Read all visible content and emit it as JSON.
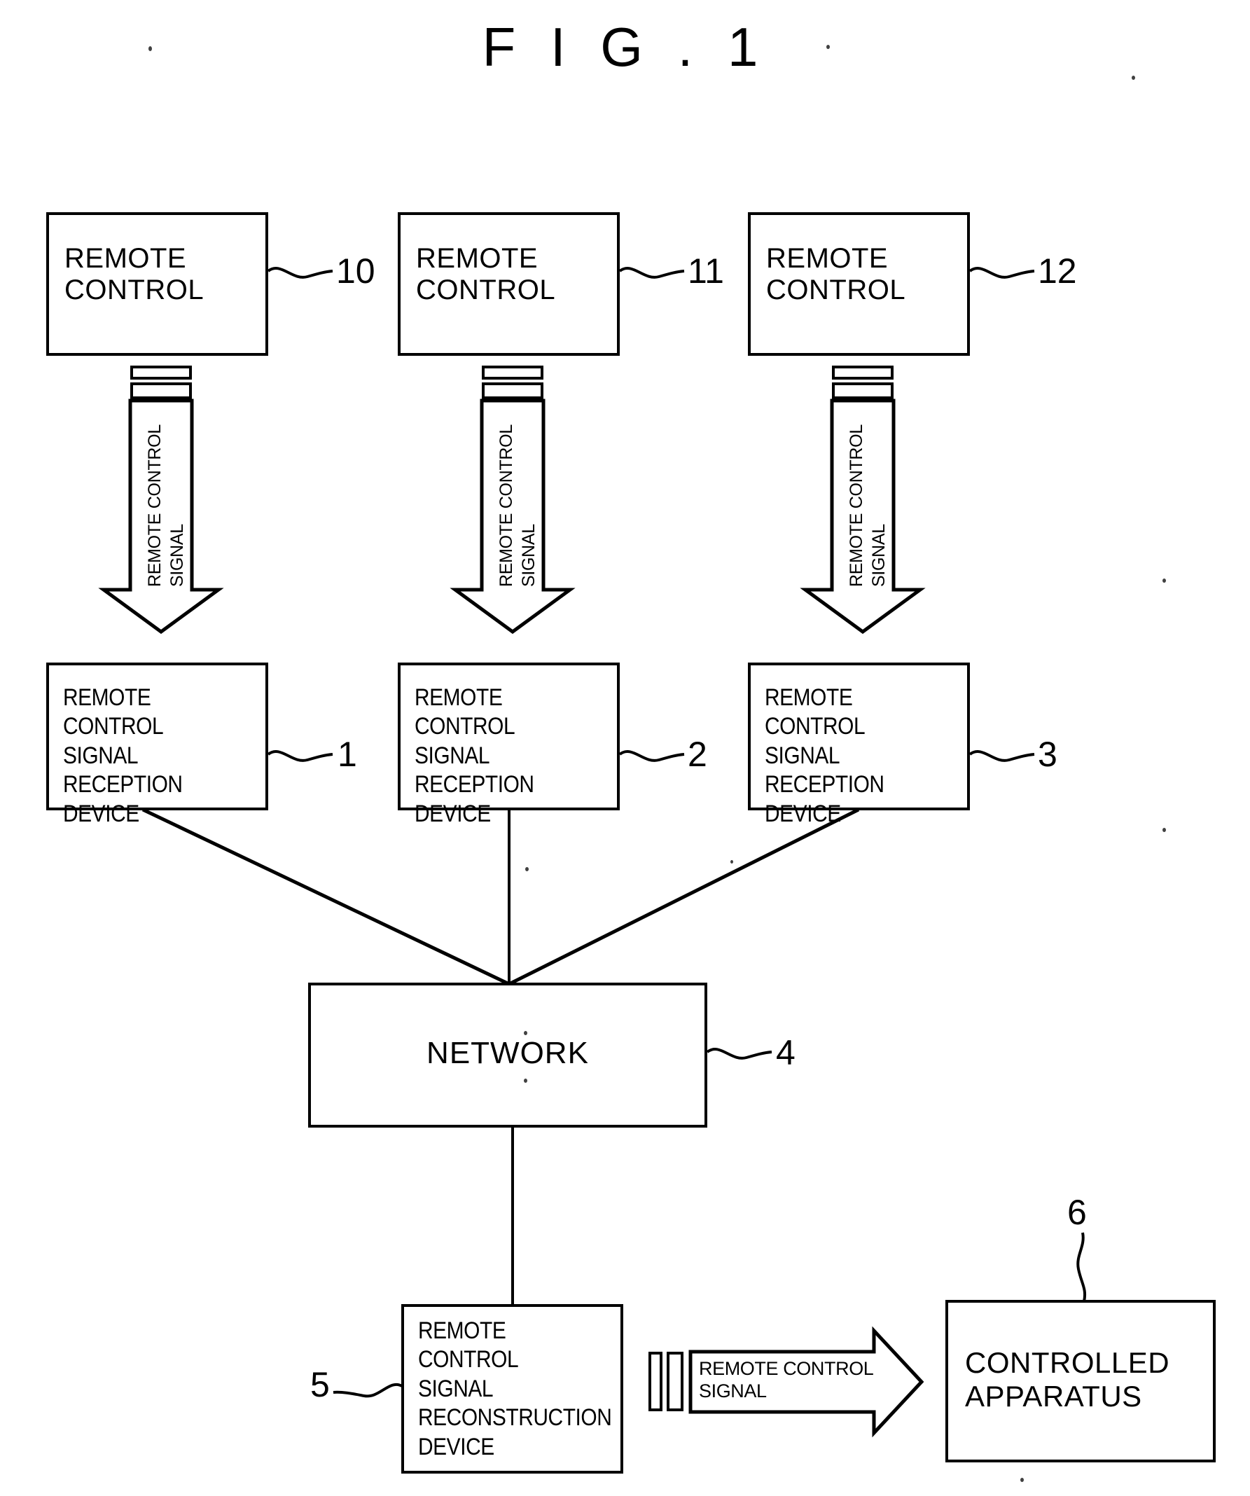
{
  "figure": {
    "title": "F I G . 1"
  },
  "remote_controls": [
    {
      "id": "rc-10",
      "label": "REMOTE\nCONTROL",
      "ref": "10"
    },
    {
      "id": "rc-11",
      "label": "REMOTE\nCONTROL",
      "ref": "11"
    },
    {
      "id": "rc-12",
      "label": "REMOTE\nCONTROL",
      "ref": "12"
    }
  ],
  "signal_arrows_vertical": [
    {
      "id": "sig-1",
      "line1": "REMOTE CONTROL",
      "line2": "SIGNAL"
    },
    {
      "id": "sig-2",
      "line1": "REMOTE CONTROL",
      "line2": "SIGNAL"
    },
    {
      "id": "sig-3",
      "line1": "REMOTE CONTROL",
      "line2": "SIGNAL"
    }
  ],
  "reception_devices": [
    {
      "id": "rx-1",
      "label": "REMOTE CONTROL\nSIGNAL RECEPTION\nDEVICE",
      "ref": "1"
    },
    {
      "id": "rx-2",
      "label": "REMOTE CONTROL\nSIGNAL RECEPTION\nDEVICE",
      "ref": "2"
    },
    {
      "id": "rx-3",
      "label": "REMOTE CONTROL\nSIGNAL RECEPTION\nDEVICE",
      "ref": "3"
    }
  ],
  "network": {
    "label": "NETWORK",
    "ref": "4"
  },
  "reconstruction_device": {
    "label": "REMOTE CONTROL\nSIGNAL\nRECONSTRUCTION\nDEVICE",
    "ref": "5"
  },
  "signal_arrow_horizontal": {
    "label": "REMOTE CONTROL\nSIGNAL"
  },
  "controlled_apparatus": {
    "label": "CONTROLLED\nAPPARATUS",
    "ref": "6"
  },
  "colors": {
    "ink": "#000000",
    "paper": "#ffffff"
  }
}
